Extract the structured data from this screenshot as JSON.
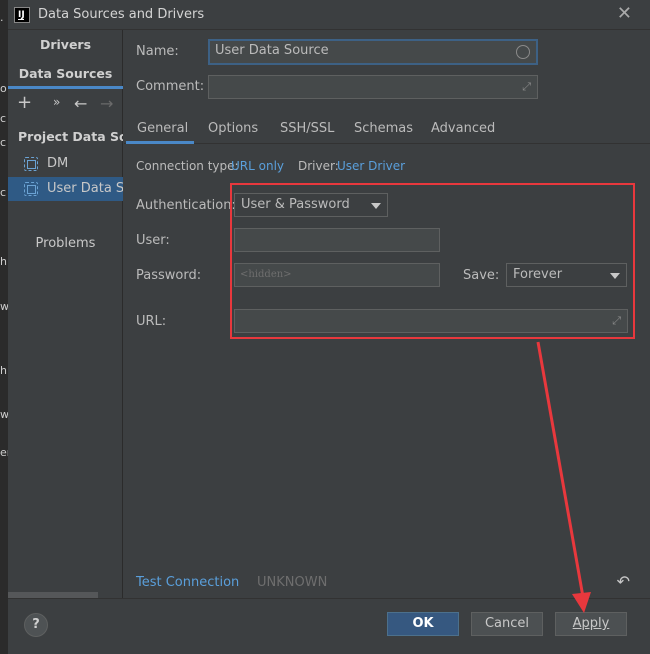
{
  "window": {
    "title": "Data Sources and Drivers",
    "app_icon": "IJ"
  },
  "sidebar": {
    "tabs": {
      "drivers": "Drivers",
      "data_sources": "Data Sources"
    },
    "toolbar": {
      "add": "+",
      "more": "»",
      "back": "←",
      "forward": "→"
    },
    "group_header": "Project Data Sou...",
    "items": [
      {
        "label": "DM",
        "selected": false
      },
      {
        "label": "User Data So",
        "selected": true
      }
    ],
    "problems": "Problems"
  },
  "form": {
    "name_label": "Name:",
    "name_value": "User Data Source",
    "comment_label": "Comment:",
    "comment_value": ""
  },
  "tabs": [
    "General",
    "Options",
    "SSH/SSL",
    "Schemas",
    "Advanced"
  ],
  "connection": {
    "type_label": "Connection type:",
    "type_value": "URL only",
    "driver_label": "Driver:",
    "driver_value": "User Driver"
  },
  "auth": {
    "label": "Authentication:",
    "value": "User & Password",
    "user_label": "User:",
    "user_value": "",
    "password_label": "Password:",
    "password_placeholder": "<hidden>",
    "save_label": "Save:",
    "save_value": "Forever",
    "url_label": "URL:",
    "url_value": ""
  },
  "bottom": {
    "test_connection": "Test Connection",
    "status": "UNKNOWN"
  },
  "footer": {
    "help": "?",
    "ok": "OK",
    "cancel": "Cancel",
    "apply": "Apply"
  },
  "annotation": {
    "color": "#e8383d"
  },
  "colors": {
    "accent": "#4a88c7",
    "link": "#5a9fdb",
    "ok_button": "#365880",
    "selection": "#2f5a85"
  }
}
